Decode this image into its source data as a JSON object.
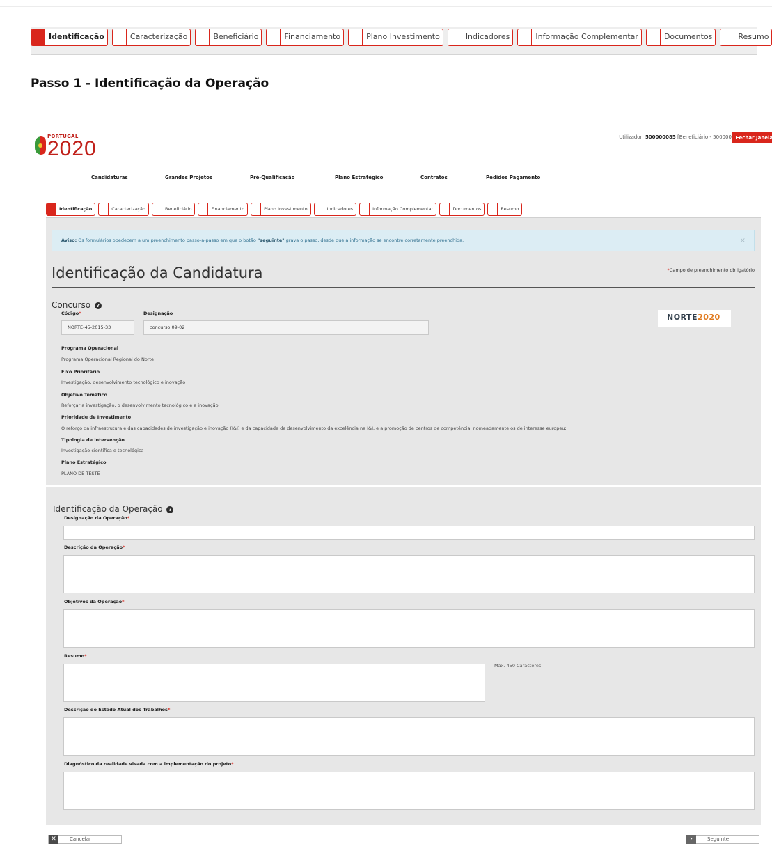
{
  "stepbar": {
    "tabs": [
      {
        "label": "Identificação",
        "active": true
      },
      {
        "label": "Caracterização",
        "active": false
      },
      {
        "label": "Beneficiário",
        "active": false
      },
      {
        "label": "Financiamento",
        "active": false
      },
      {
        "label": "Plano Investimento",
        "active": false
      },
      {
        "label": "Indicadores",
        "active": false
      },
      {
        "label": "Informação Complementar",
        "active": false
      },
      {
        "label": "Documentos",
        "active": false
      },
      {
        "label": "Resumo",
        "active": false
      }
    ]
  },
  "page_heading": "Passo 1 - Identificação da Operação",
  "portal": {
    "logo": {
      "small": "PORTUGAL",
      "big": "2020"
    },
    "user": {
      "prefix": "Utilizador:",
      "id": "500000085",
      "role": "[Beneficiário - 500000085]"
    },
    "close_label": "Fechar Janela",
    "nav": [
      "Candidaturas",
      "Grandes Projetos",
      "Pré-Qualificação",
      "Plano Estratégico",
      "Contratos",
      "Pedidos Pagamento"
    ],
    "alert": {
      "label": "Aviso:",
      "text_a": " Os formulários obedecem a um preenchimento passo-a-passo em que o botão ",
      "keyword": "\"seguinte\"",
      "text_b": " grava o passo, desde que a informação se encontre corretamente preenchida.",
      "close": "×"
    },
    "title": "Identificação da Candidatura",
    "required_note": "Campo de preenchimento obrigatório",
    "required_mark": "*",
    "concurso": {
      "heading": "Concurso",
      "help": "?",
      "codigo_label": "Código",
      "codigo_value": "NORTE-45-2015-33",
      "designacao_label": "Designação",
      "designacao_value": "concurso 09-02",
      "badge": {
        "a": "NORTE",
        "b": "2020"
      }
    },
    "info": [
      {
        "label": "Programa Operacional",
        "value": "Programa Operacional Regional do Norte"
      },
      {
        "label": "Eixo Prioritário",
        "value": "Investigação, desenvolvimento tecnológico e inovação"
      },
      {
        "label": "Objetivo Temático",
        "value": "Reforçar a investigação, o desenvolvimento tecnológico e a inovação"
      },
      {
        "label": "Prioridade de Investimento",
        "value": "O reforço da infraestrutura e das capacidades de investigação e inovação (I&I) e da capacidade de desenvolvimento da excelência na I&I, e a promoção de centros de competência, nomeadamente os de interesse europeu;"
      },
      {
        "label": "Tipologia de intervenção",
        "value": "Investigação científica e tecnológica"
      },
      {
        "label": "Plano Estratégico",
        "value": "PLANO DE TESTE"
      }
    ],
    "operacao": {
      "heading": "Identificação da Operação",
      "help": "?",
      "fields": [
        {
          "label": "Designação da Operação",
          "value": ""
        },
        {
          "label": "Descrição da Operação",
          "value": ""
        },
        {
          "label": "Objetivos da Operação",
          "value": ""
        },
        {
          "label": "Resumo",
          "value": ""
        },
        {
          "label": "Descrição do Estado Atual dos Trabalhos",
          "value": ""
        },
        {
          "label": "Diagnóstico da realidade visada com a implementação do projeto",
          "value": ""
        }
      ],
      "max_chars": "Max. 450 Caracteres"
    },
    "buttons": {
      "cancel": "Cancelar",
      "cancel_icon": "✕",
      "next": "Seguinte",
      "next_icon": "›"
    }
  }
}
